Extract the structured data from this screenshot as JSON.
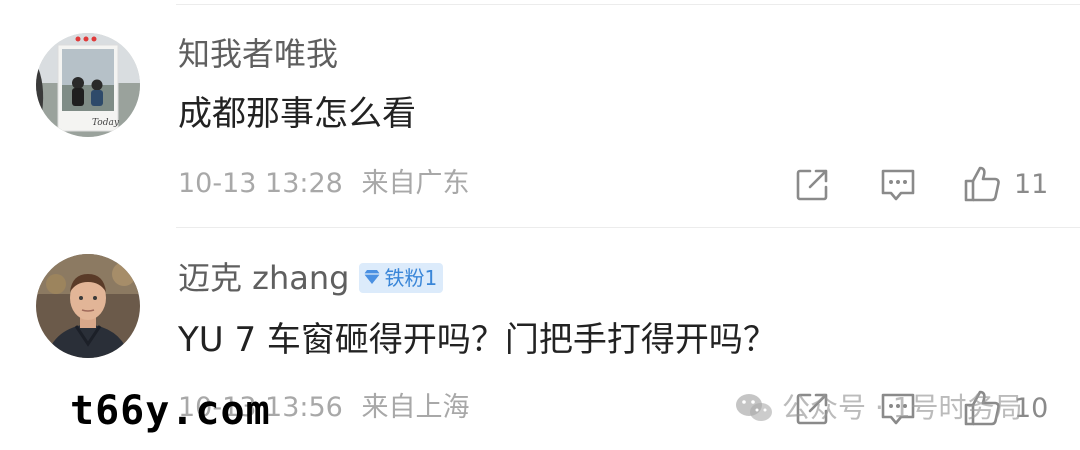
{
  "comments": [
    {
      "username": "知我者唯我",
      "text": "成都那事怎么看",
      "time": "10-13 13:28",
      "location": "来自广东",
      "likes": "11",
      "badge": null,
      "avatar_icon": "avatar-girls-photo-icon"
    },
    {
      "username": "迈克 zhang",
      "text": "YU 7 车窗砸得开吗？门把手打得开吗？",
      "time": "10-13 13:56",
      "location": "来自上海",
      "likes": "10",
      "badge": "铁粉1",
      "avatar_icon": "avatar-man-photo-icon"
    }
  ],
  "watermarks": {
    "left": "t66y.com",
    "right": "公众号 · 1号时务局"
  },
  "colors": {
    "username": "#5f5f5f",
    "content": "#222222",
    "meta": "#a8a8a8",
    "icon": "#8a8a8a",
    "badge_bg": "#dcebfb",
    "badge_text": "#3a86d8"
  }
}
